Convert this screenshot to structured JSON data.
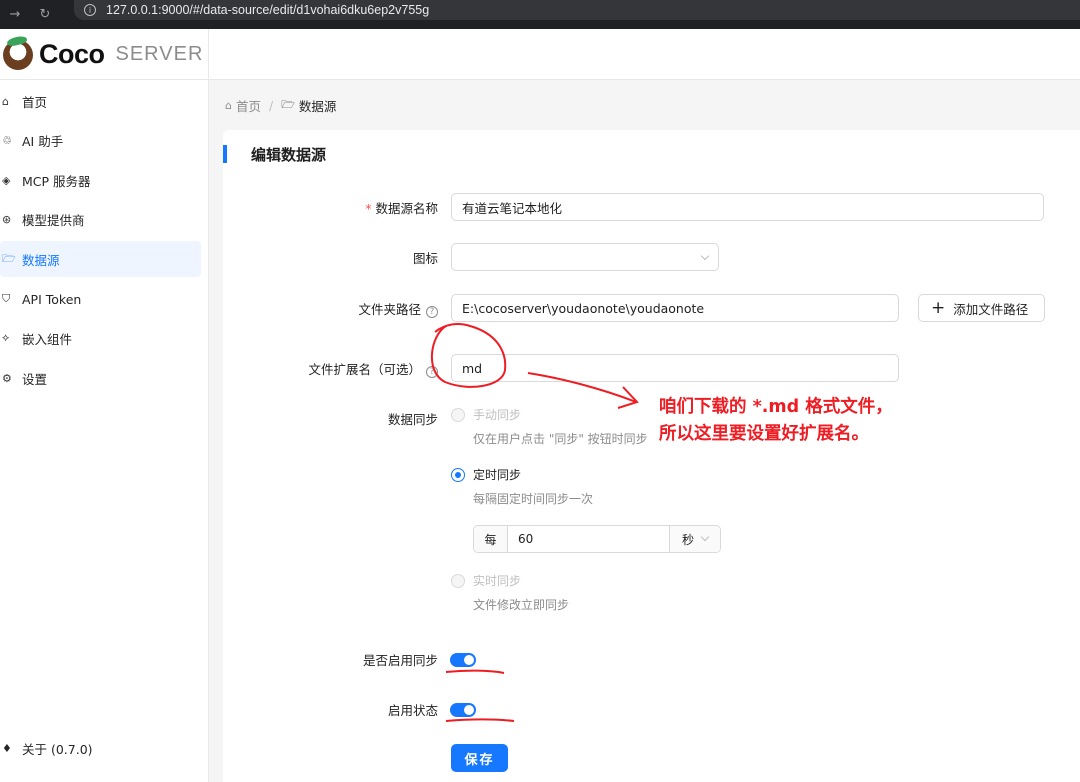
{
  "browser": {
    "url": "127.0.0.1:9000/#/data-source/edit/d1vohai6dku6ep2v755g",
    "back_icon": "←",
    "forward_icon": "→",
    "reload_icon": "↻",
    "info_icon": "i"
  },
  "brand": {
    "name": "Coco",
    "sub": "SERVER"
  },
  "sidebar": {
    "items": [
      {
        "label": "首页",
        "icon": "⌂"
      },
      {
        "label": "AI 助手",
        "icon": "♲"
      },
      {
        "label": "MCP 服务器",
        "icon": "◈"
      },
      {
        "label": "模型提供商",
        "icon": "⊛"
      },
      {
        "label": "数据源",
        "icon": "🗁"
      },
      {
        "label": "API Token",
        "icon": "⛉"
      },
      {
        "label": "嵌入组件",
        "icon": "⟡"
      },
      {
        "label": "设置",
        "icon": "⚙"
      }
    ],
    "active_index": 4,
    "about": {
      "label": "关于 (0.7.0)",
      "icon": "♦"
    }
  },
  "breadcrumb": {
    "home": "首页",
    "home_icon": "⌂",
    "current": "数据源",
    "current_icon": "🗁",
    "separator": "/"
  },
  "form": {
    "title": "编辑数据源",
    "name_label": "数据源名称",
    "name_value": "有道云笔记本地化",
    "icon_label": "图标",
    "icon_value": "",
    "path_label": "文件夹路径",
    "path_value": "E:\\cocoserver\\youdaonote\\youdaonote",
    "add_path_label": "添加文件路径",
    "ext_label": "文件扩展名（可选）",
    "ext_value": "md",
    "sync_label": "数据同步",
    "sync_options": [
      {
        "label": "手动同步",
        "hint": "仅在用户点击 \"同步\" 按钮时同步",
        "selected": false,
        "disabled": true
      },
      {
        "label": "定时同步",
        "hint": "每隔固定时间同步一次",
        "selected": true,
        "disabled": false
      },
      {
        "label": "实时同步",
        "hint": "文件修改立即同步",
        "selected": false,
        "disabled": true
      }
    ],
    "interval_prefix": "每",
    "interval_value": "60",
    "interval_unit": "秒",
    "enable_sync_label": "是否启用同步",
    "enable_sync_on": true,
    "enabled_label": "启用状态",
    "enabled_on": true,
    "save_label": "保存"
  },
  "annotation": {
    "line1": "咱们下载的 *.md 格式文件，",
    "line2": "所以这里要设置好扩展名。",
    "color": "#ee1d24"
  },
  "colors": {
    "primary": "#1677ff",
    "danger": "#ff4d4f"
  }
}
